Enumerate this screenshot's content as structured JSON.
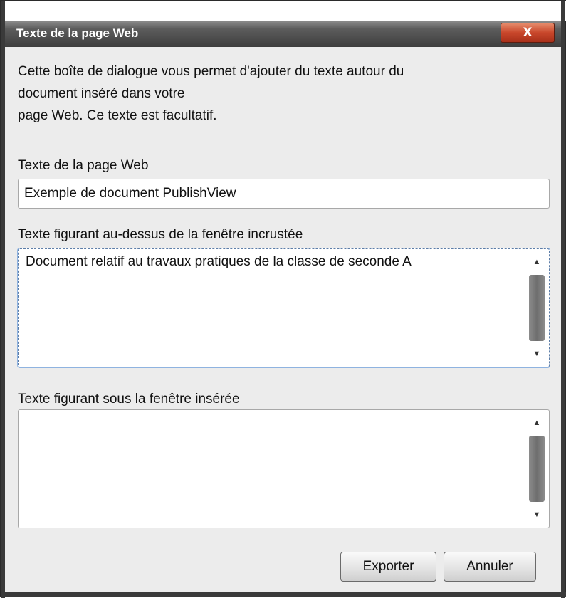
{
  "window": {
    "title": "Texte de la page Web",
    "close_glyph": "X"
  },
  "intro": {
    "line1": "Cette boîte de dialogue vous permet d'ajouter du texte autour du",
    "line2": "document inséré dans votre",
    "line3": "page Web. Ce texte est facultatif."
  },
  "page_text": {
    "label": "Texte de la page Web",
    "value": "Exemple de document PublishView"
  },
  "above_text": {
    "label": "Texte figurant au-dessus de la fenêtre incrustée",
    "value": "Document relatif au travaux pratiques de la classe de seconde A"
  },
  "below_text": {
    "label": "Texte figurant sous la fenêtre insérée",
    "value": ""
  },
  "buttons": {
    "export": "Exporter",
    "cancel": "Annuler"
  },
  "icons": {
    "scroll_up": "▲",
    "scroll_down": "▼"
  },
  "colors": {
    "close_button": "#c9472b",
    "titlebar": "#4a4a4a",
    "dialog_bg": "#ececec"
  }
}
